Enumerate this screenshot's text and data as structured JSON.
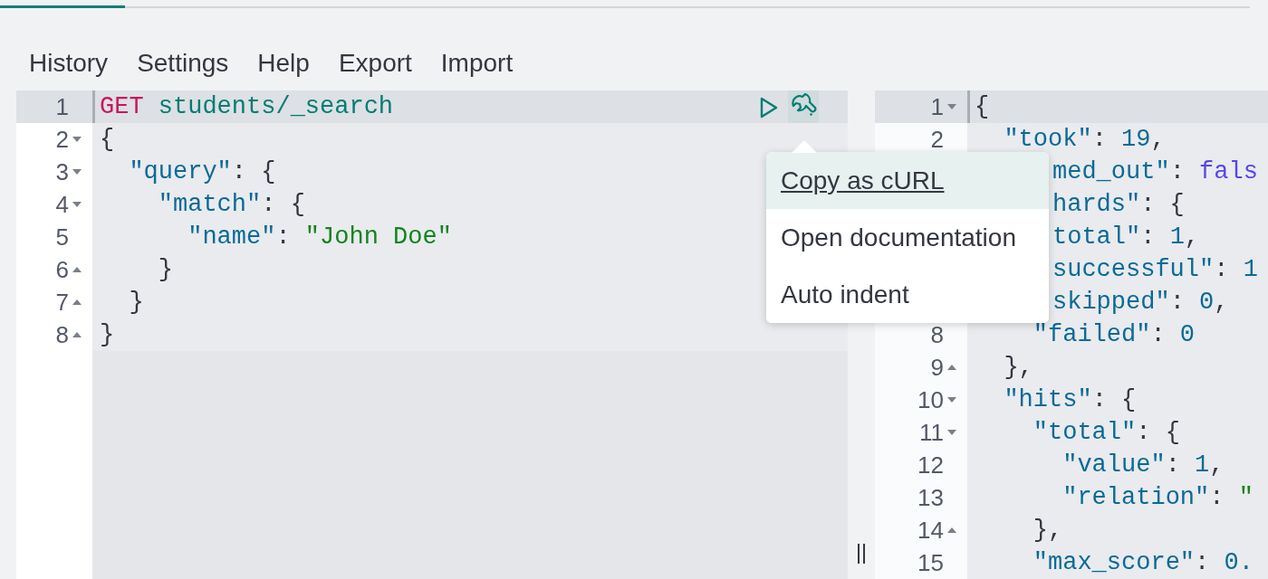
{
  "menu": [
    "History",
    "Settings",
    "Help",
    "Export",
    "Import"
  ],
  "request": {
    "lines": [
      {
        "num": "1",
        "active": true,
        "tokens": [
          {
            "kind": "method",
            "text": "GET"
          },
          {
            "kind": "path",
            "text": " students/_search"
          }
        ]
      },
      {
        "num": "2",
        "fold_start": true,
        "tokens": [
          {
            "kind": "punct",
            "text": "{"
          }
        ]
      },
      {
        "num": "3",
        "fold_start": true,
        "tokens": [
          {
            "kind": "key",
            "text": "  \"query\""
          },
          {
            "kind": "punct",
            "text": ": {"
          }
        ]
      },
      {
        "num": "4",
        "fold_start": true,
        "tokens": [
          {
            "kind": "key",
            "text": "    \"match\""
          },
          {
            "kind": "punct",
            "text": ": {"
          }
        ]
      },
      {
        "num": "5",
        "tokens": [
          {
            "kind": "key",
            "text": "      \"name\""
          },
          {
            "kind": "punct",
            "text": ": "
          },
          {
            "kind": "string",
            "text": "\"John Doe\""
          }
        ]
      },
      {
        "num": "6",
        "fold_start": false,
        "tokens": [
          {
            "kind": "punct",
            "text": "    }"
          }
        ]
      },
      {
        "num": "7",
        "fold_start": false,
        "tokens": [
          {
            "kind": "punct",
            "text": "  }"
          }
        ]
      },
      {
        "num": "8",
        "fold_start": false,
        "tokens": [
          {
            "kind": "punct",
            "text": "}"
          }
        ]
      }
    ]
  },
  "actions_menu": {
    "open": true,
    "items": [
      {
        "label": "Copy as cURL",
        "selected": true
      },
      {
        "label": "Open documentation",
        "selected": false
      },
      {
        "label": "Auto indent",
        "selected": false
      }
    ]
  },
  "response": {
    "lines": [
      {
        "num": "1",
        "fold_start": true,
        "active": true,
        "tokens": [
          {
            "kind": "punct",
            "text": "{"
          }
        ]
      },
      {
        "num": "2",
        "tokens": [
          {
            "kind": "key",
            "text": "  \"took\""
          },
          {
            "kind": "punct",
            "text": ": "
          },
          {
            "kind": "number",
            "text": "19"
          },
          {
            "kind": "punct",
            "text": ","
          }
        ]
      },
      {
        "kind": "fragment",
        "tokens": [
          {
            "kind": "key",
            "text": "med_out\""
          },
          {
            "kind": "punct",
            "text": ": "
          },
          {
            "kind": "bool",
            "text": "fals"
          }
        ]
      },
      {
        "kind": "fragment",
        "tokens": [
          {
            "kind": "key",
            "text": "hards\""
          },
          {
            "kind": "punct",
            "text": ": {"
          }
        ]
      },
      {
        "kind": "fragment",
        "tokens": [
          {
            "kind": "key",
            "text": "total\""
          },
          {
            "kind": "punct",
            "text": ": "
          },
          {
            "kind": "number",
            "text": "1"
          },
          {
            "kind": "punct",
            "text": ","
          }
        ]
      },
      {
        "kind": "fragment",
        "tokens": [
          {
            "kind": "key",
            "text": "successful\""
          },
          {
            "kind": "punct",
            "text": ": "
          },
          {
            "kind": "number",
            "text": "1"
          }
        ]
      },
      {
        "kind": "fragment",
        "tokens": [
          {
            "kind": "key",
            "text": "skipped\""
          },
          {
            "kind": "punct",
            "text": ": "
          },
          {
            "kind": "number",
            "text": "0"
          },
          {
            "kind": "punct",
            "text": ","
          }
        ]
      },
      {
        "num": "8",
        "tokens": [
          {
            "kind": "key",
            "text": "    \"failed\""
          },
          {
            "kind": "punct",
            "text": ": "
          },
          {
            "kind": "number",
            "text": "0"
          }
        ]
      },
      {
        "num": "9",
        "fold_start": false,
        "tokens": [
          {
            "kind": "punct",
            "text": "  },"
          }
        ]
      },
      {
        "num": "10",
        "fold_start": true,
        "tokens": [
          {
            "kind": "key",
            "text": "  \"hits\""
          },
          {
            "kind": "punct",
            "text": ": {"
          }
        ]
      },
      {
        "num": "11",
        "fold_start": true,
        "tokens": [
          {
            "kind": "key",
            "text": "    \"total\""
          },
          {
            "kind": "punct",
            "text": ": {"
          }
        ]
      },
      {
        "num": "12",
        "tokens": [
          {
            "kind": "key",
            "text": "      \"value\""
          },
          {
            "kind": "punct",
            "text": ": "
          },
          {
            "kind": "number",
            "text": "1"
          },
          {
            "kind": "punct",
            "text": ","
          }
        ]
      },
      {
        "num": "13",
        "tokens": [
          {
            "kind": "key",
            "text": "      \"relation\""
          },
          {
            "kind": "punct",
            "text": ": "
          },
          {
            "kind": "string",
            "text": "\""
          }
        ]
      },
      {
        "num": "14",
        "fold_start": false,
        "tokens": [
          {
            "kind": "punct",
            "text": "    },"
          }
        ]
      },
      {
        "num": "15",
        "tokens": [
          {
            "kind": "key",
            "text": "    \"max_score\""
          },
          {
            "kind": "punct",
            "text": ": "
          },
          {
            "kind": "number",
            "text": "0."
          }
        ]
      }
    ]
  }
}
